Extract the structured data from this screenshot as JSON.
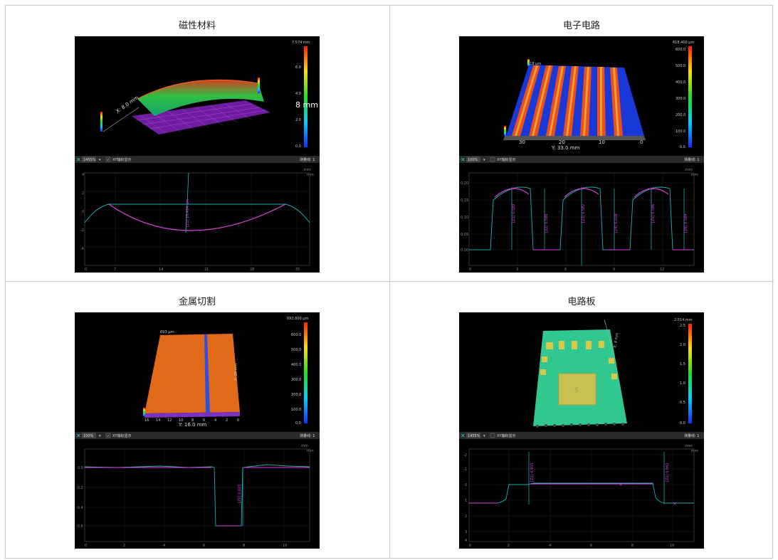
{
  "cells": [
    {
      "title": "磁性材料",
      "scale_max": "7.574 mm",
      "scale_ticks": [
        "6.0",
        "4.0",
        "2.0",
        "0.0"
      ],
      "overlay": "8 mm",
      "axis_label": "X: 8.0 mm",
      "toolbar": {
        "zoom": "1455%",
        "check_label": "XY轴标显示",
        "count": "测量线: 1"
      },
      "unit": "mm",
      "profile_yticks": [
        "4",
        "2",
        "0",
        "-2",
        "-4"
      ],
      "profile_xticks": [
        "0",
        "7",
        "14",
        "21",
        "28",
        "35"
      ],
      "annotations": [
        "[Z1] 25.494 um"
      ]
    },
    {
      "title": "电子电路",
      "scale_max": "618.400 µm",
      "scale_ticks": [
        "600.0",
        "500.0",
        "400.0",
        "300.0",
        "200.0",
        "100.0",
        "0.0"
      ],
      "axis_label": "Y: 33.0 mm",
      "axis_ticks": [
        "30",
        "20",
        "10",
        "0"
      ],
      "corner_label": "618 µm",
      "toolbar": {
        "zoom": "100%",
        "check_label": "XY轴标显示",
        "count": "测量线: 1"
      },
      "unit": "mm",
      "profile_yticks": [
        "0.20",
        "0.15",
        "0.10",
        "0.05",
        "0.00"
      ],
      "profile_xticks": [
        "0",
        "3",
        "6",
        "9",
        "12"
      ],
      "annotations": [
        "[Z1] 0.589",
        "[Z2] 0.588",
        "[Z3] 0.582",
        "[Z4] 0.558",
        "[Z5] 0.586",
        "[Z6] 0.584"
      ]
    },
    {
      "title": "金属切割",
      "scale_max": "692.800 µm",
      "scale_ticks": [
        "600.0",
        "500.0",
        "400.0",
        "300.0",
        "200.0",
        "100.0",
        "0.0"
      ],
      "axis_label": "Y: 16.0 mm",
      "axis_ticks": [
        "16",
        "14",
        "12",
        "10",
        "8",
        "6",
        "4",
        "2",
        "0"
      ],
      "corner_label": "693 µm",
      "side_label": "X: 20 mm",
      "toolbar": {
        "zoom": "100%",
        "check_label": "XY轴标显示",
        "count": "测量线: 1"
      },
      "unit": "mm",
      "profile_yticks": [
        "0.0",
        "-0.2",
        "-0.4",
        "-0.6"
      ],
      "profile_xticks": [
        "0",
        "2",
        "4",
        "6",
        "8",
        "10"
      ],
      "annotations": [
        "[Z1] 0.621"
      ]
    },
    {
      "title": "电路板",
      "scale_max": "2.514 mm",
      "scale_ticks": [
        "2.5",
        "2.0",
        "1.5",
        "1.0",
        "0.5",
        "0.0"
      ],
      "side_label": "X: 4 mm",
      "toolbar": {
        "zoom": "1455%",
        "check_label": "XY轴标显示",
        "count": "测量线: 1"
      },
      "unit": "mm",
      "profile_yticks": [
        "-2",
        "-1",
        "0",
        "1",
        "2",
        "3",
        "4"
      ],
      "profile_xticks": [
        "0",
        "2",
        "4",
        "6",
        "8",
        "10"
      ],
      "annotations": [
        "[Z1] 0.933",
        "[Z2] 0.942"
      ]
    }
  ]
}
